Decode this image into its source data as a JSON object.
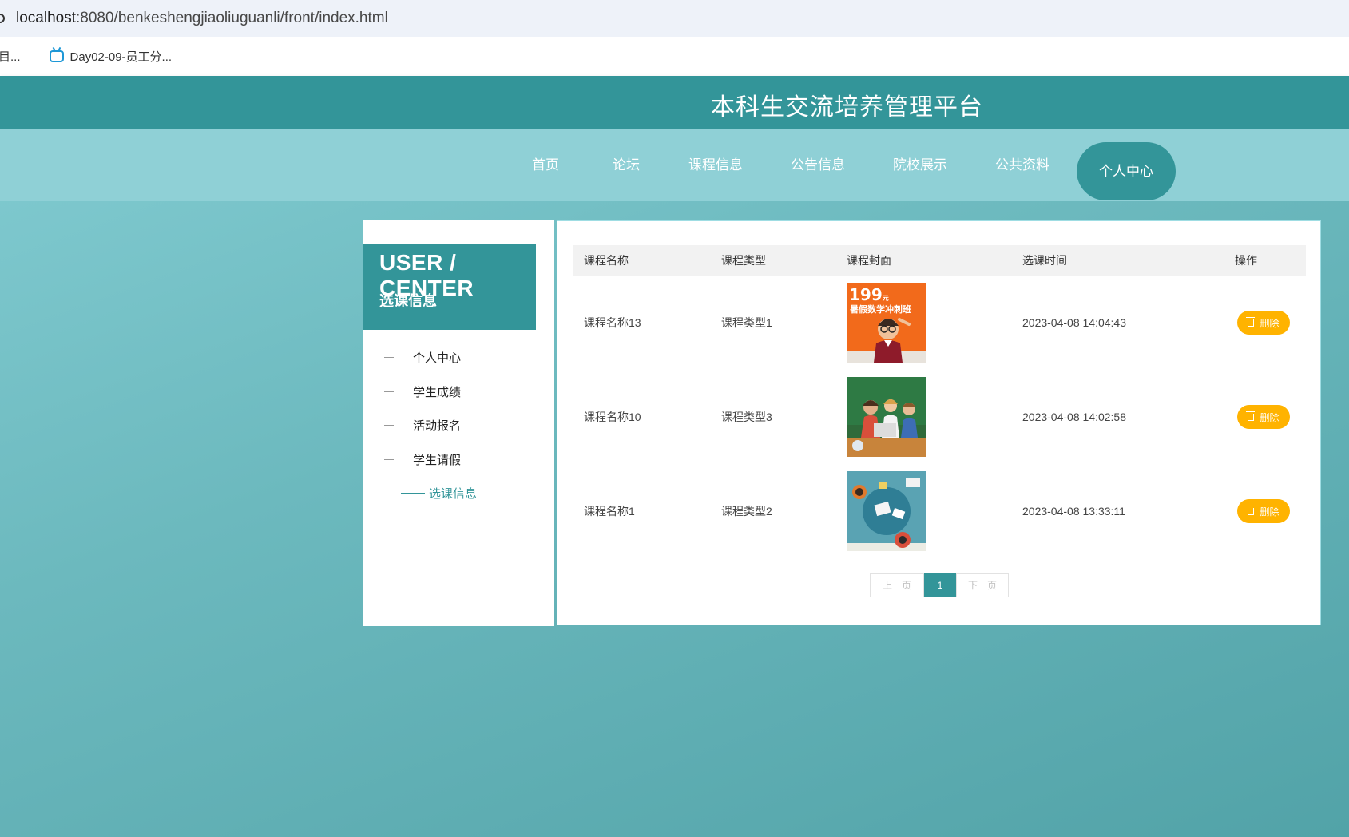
{
  "browser": {
    "url_host": "localhost",
    "url_rest": ":8080/benkeshengjiaoliuguanli/front/index.html",
    "bookmark_truncated": "目...",
    "bookmark_label": "Day02-09-员工分..."
  },
  "site": {
    "title": "本科生交流培养管理平台"
  },
  "nav": {
    "items": [
      "首页",
      "论坛",
      "课程信息",
      "公告信息",
      "院校展示",
      "公共资料",
      "个人中心"
    ],
    "active": "个人中心"
  },
  "user_center": {
    "title": "USER / CENTER",
    "subtitle": "选课信息",
    "menu": [
      "个人中心",
      "学生成绩",
      "活动报名",
      "学生请假",
      "选课信息"
    ]
  },
  "table": {
    "headers": [
      "课程名称",
      "课程类型",
      "课程封面",
      "选课时间",
      "操作"
    ],
    "rows": [
      {
        "name": "课程名称13",
        "type": "课程类型1",
        "cover": "summer-math-class-poster",
        "cover_text": "199元 暑假数学冲刺班",
        "time": "2023-04-08 14:04:43",
        "action": "删除"
      },
      {
        "name": "课程名称10",
        "type": "课程类型3",
        "cover": "kids-at-laptop-photo",
        "time": "2023-04-08 14:02:58",
        "action": "删除"
      },
      {
        "name": "课程名称1",
        "type": "课程类型2",
        "cover": "desk-top-view-illustration",
        "time": "2023-04-08 13:33:11",
        "action": "删除"
      }
    ]
  },
  "pagination": {
    "prev": "上一页",
    "current": "1",
    "next": "下一页"
  },
  "colors": {
    "primary": "#339599",
    "nav": "#8fd0d6",
    "delete": "#ffb300",
    "poster": "#f26a1b"
  }
}
